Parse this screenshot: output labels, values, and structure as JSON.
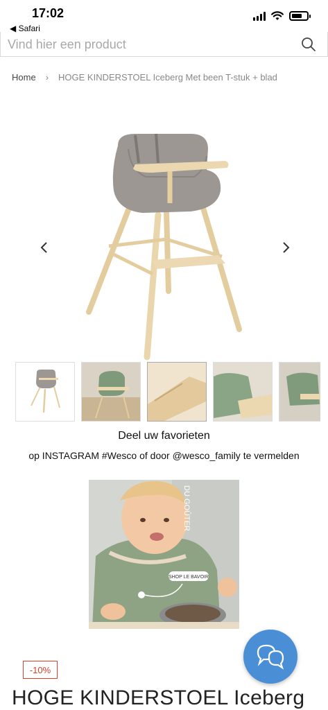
{
  "status_bar": {
    "time": "17:02",
    "back_label": "◀ Safari",
    "icons": [
      "signal-icon",
      "wifi-icon",
      "battery-icon"
    ]
  },
  "search": {
    "placeholder": "Vind hier een product",
    "icon": "search-icon"
  },
  "breadcrumb": {
    "home": "Home",
    "separator": "›",
    "current": "HOGE KINDERSTOEL Iceberg Met been T-stuk + blad"
  },
  "gallery": {
    "prev_icon": "chevron-left-icon",
    "next_icon": "chevron-right-icon",
    "thumbnail_count_visible": 5
  },
  "instagram": {
    "title": "Deel uw favorieten",
    "subtitle": "op INSTAGRAM #Wesco of door @wesco_family te vermelden",
    "photo_text_vertical": "DU GOÛTER",
    "photo_tag": "SHOP LE BAVOIR"
  },
  "chat": {
    "icon": "chat-bubbles-icon"
  },
  "product": {
    "discount": "-10%",
    "title": "HOGE KINDERSTOEL Iceberg"
  },
  "colors": {
    "chat_button": "#4a8fd6",
    "discount": "#d8402b",
    "chair_shell": "#9b9591",
    "wood": "#e8d3a8"
  }
}
